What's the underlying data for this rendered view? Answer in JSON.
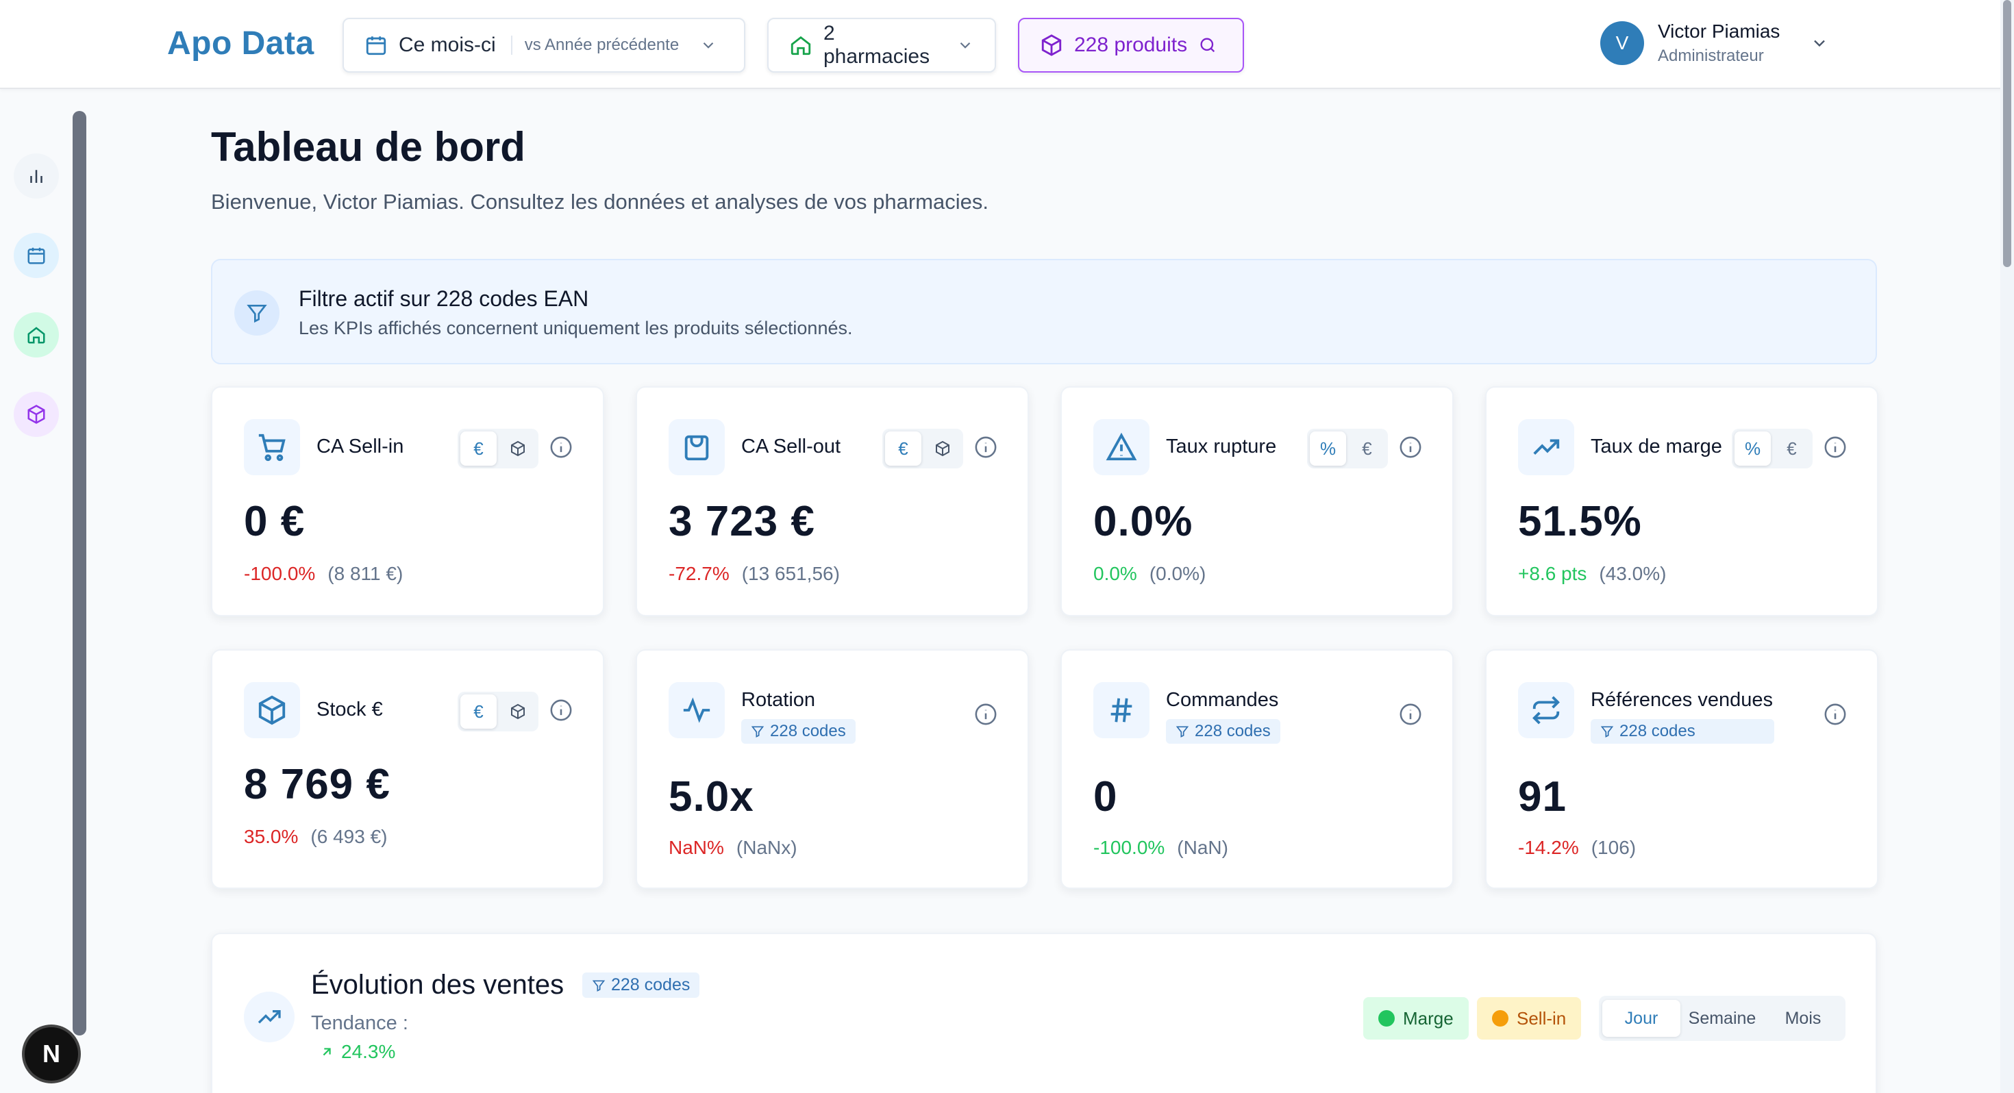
{
  "header": {
    "logo": "Apo Data",
    "period_label": "Ce mois-ci",
    "period_compare": "vs Année précédente",
    "pharmacies_label": "2 pharmacies",
    "products_label": "228 produits",
    "user_initial": "V",
    "user_name": "Victor Piamias",
    "user_role": "Administrateur"
  },
  "sidebar": {
    "items": [
      {
        "icon": "bar-chart-icon"
      },
      {
        "icon": "calendar-icon"
      },
      {
        "icon": "home-icon"
      },
      {
        "icon": "box-icon"
      }
    ],
    "dev_badge": "N"
  },
  "page": {
    "title": "Tableau de bord",
    "subtitle": "Bienvenue, Victor Piamias. Consultez les données et analyses de vos pharmacies."
  },
  "filter": {
    "title": "Filtre actif sur 228 codes EAN",
    "description": "Les KPIs affichés concernent uniquement les produits sélectionnés."
  },
  "kpis": [
    {
      "title": "CA Sell-in",
      "toggle": [
        "€",
        "box"
      ],
      "value": "0 €",
      "delta": "-100.0%",
      "delta_type": "neg",
      "previous": "(8 811 €)"
    },
    {
      "title": "CA Sell-out",
      "toggle": [
        "€",
        "box"
      ],
      "value": "3 723 €",
      "delta": "-72.7%",
      "delta_type": "neg",
      "previous": "(13 651,56)"
    },
    {
      "title": "Taux rupture",
      "toggle": [
        "%",
        "€"
      ],
      "value": "0.0%",
      "delta": "0.0%",
      "delta_type": "pos",
      "previous": "(0.0%)"
    },
    {
      "title": "Taux de marge",
      "toggle": [
        "%",
        "€"
      ],
      "value": "51.5%",
      "delta": "+8.6 pts",
      "delta_type": "pos",
      "previous": "(43.0%)"
    },
    {
      "title": "Stock €",
      "toggle": [
        "€",
        "box"
      ],
      "value": "8 769 €",
      "delta": "35.0%",
      "delta_type": "neg",
      "previous": "(6 493 €)"
    },
    {
      "title": "Rotation",
      "badge": "228 codes",
      "value": "5.0x",
      "delta": "NaN%",
      "delta_type": "neg",
      "previous": "(NaNx)"
    },
    {
      "title": "Commandes",
      "badge": "228 codes",
      "value": "0",
      "delta": "-100.0%",
      "delta_type": "pos",
      "previous": "(NaN)"
    },
    {
      "title": "Références vendues",
      "badge": "228 codes",
      "value": "91",
      "delta": "-14.2%",
      "delta_type": "neg",
      "previous": "(106)"
    }
  ],
  "sales": {
    "title": "Évolution des ventes",
    "badge": "228 codes",
    "trend_label": "Tendance :",
    "trend_value": "24.3%",
    "legend": [
      {
        "label": "Marge",
        "color": "#22c55e"
      },
      {
        "label": "Sell-in",
        "color": "#f59e0b"
      }
    ],
    "periods": [
      "Jour",
      "Semaine",
      "Mois"
    ],
    "active_period": "Jour"
  },
  "colors": {
    "brand": "#2f7db8",
    "negative": "#dc2626",
    "positive": "#22c55e",
    "products_accent": "#a855f7"
  }
}
